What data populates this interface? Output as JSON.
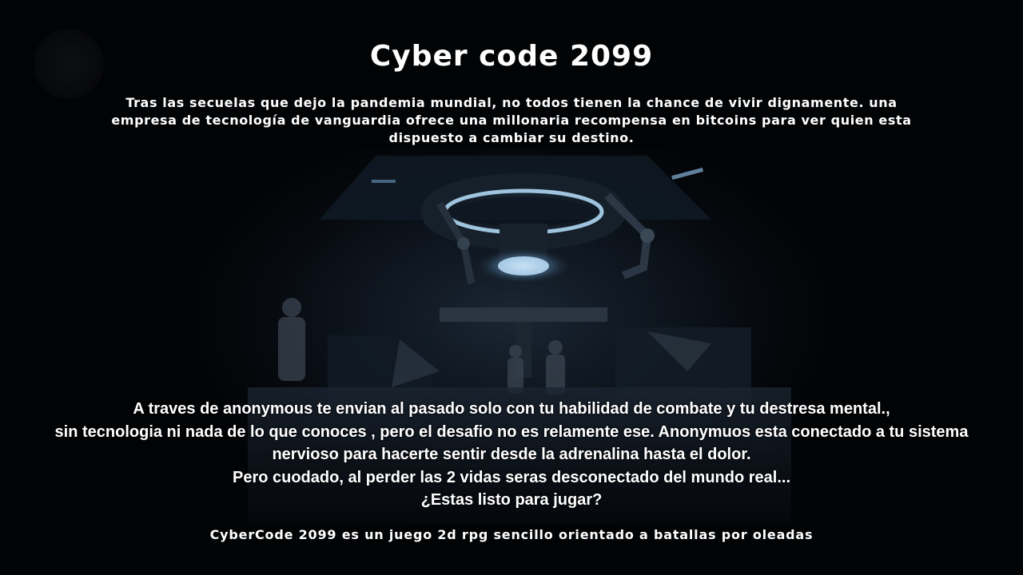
{
  "game": {
    "title": "Cyber code 2099",
    "intro_lines": [
      "Tras las secuelas que dejo la pandemia mundial, no todos tienen la chance de vivir dignamente.  una",
      "empresa de tecnología de vanguardia ofrece una millonaria recompensa en bitcoins para ver quien esta",
      "dispuesto a cambiar su destino."
    ],
    "story_lines": [
      "A traves de anonymous te envian al pasado solo con tu habilidad de combate y tu destresa mental.,",
      "sin tecnologia ni nada de lo que conoces , pero el desafio no es relamente ese.  Anonymuos esta conectado a tu sistema",
      "nervioso para hacerte sentir desde la adrenalina hasta el dolor.",
      "Pero cuodado, al perder las 2 vidas seras desconectado del mundo real...",
      "¿Estas listo para jugar?"
    ],
    "footer": "CyberCode 2099 es un juego 2d rpg sencillo orientado a batallas por oleadas"
  },
  "colors": {
    "background": "#020305",
    "text": "#ffffff",
    "scene_glow": "#9fd4ff"
  }
}
